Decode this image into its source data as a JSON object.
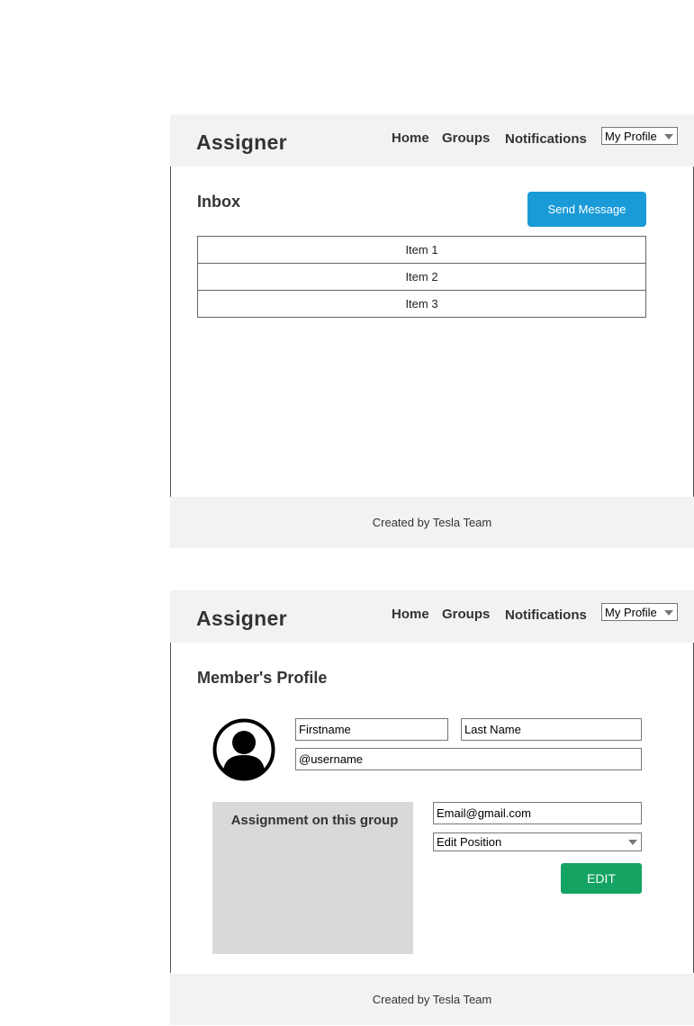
{
  "brand": "Assigner",
  "nav": {
    "home": "Home",
    "groups": "Groups",
    "notifications": "Notifications",
    "profile_select": "My Profile"
  },
  "footer": "Created by Tesla Team",
  "inbox": {
    "title": "Inbox",
    "send_button": "Send Message",
    "items": [
      "Item 1",
      "Item 2",
      "Item 3"
    ]
  },
  "profile": {
    "title": "Member's Profile",
    "firstname": "Firstname",
    "lastname": "Last Name",
    "username": "@username",
    "assignment_label": "Assignment on this group",
    "email": "Email@gmail.com",
    "position": "Edit Position",
    "edit_button": "EDIT"
  },
  "colors": {
    "send_button": "#1a9bd7",
    "edit_button": "#14a363",
    "navbar": "#f2f2f2",
    "assignment_box": "#d9d9d9"
  }
}
